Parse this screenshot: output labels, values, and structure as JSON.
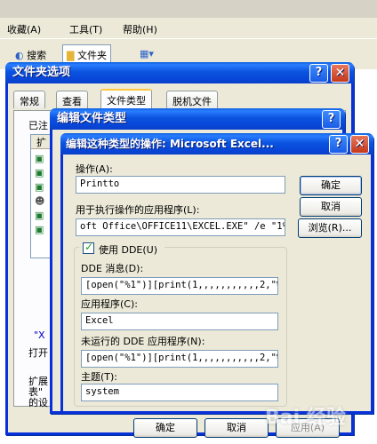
{
  "explorer": {
    "menu": [
      "收藏(A)",
      "工具(T)",
      "帮助(H)"
    ],
    "toolbar": {
      "search_label": "搜索",
      "folders_label": "文件夹"
    },
    "bottom_buttons": {
      "ok": "确定",
      "cancel": "取消",
      "apply": "应用(A)"
    }
  },
  "folder_options": {
    "title": "文件夹选项",
    "tabs": [
      "常规",
      "查看",
      "文件类型",
      "脱机文件"
    ],
    "active_tab": "文件类型",
    "registered_label": "已注",
    "list_header": "扩",
    "side_texts": [
      "\"X",
      "打开",
      "扩展",
      "表\"",
      "的设"
    ]
  },
  "edit_file_type": {
    "title": "编辑文件类型"
  },
  "edit_action": {
    "title": "编辑这种类型的操作: Microsoft Excel...",
    "action_label": "操作(A):",
    "action_value": "Printto",
    "app_label": "用于执行操作的应用程序(L):",
    "app_value": "oft Office\\OFFICE11\\EXCEL.EXE\" /e \"1%\"",
    "ok_button": "确定",
    "cancel_button": "取消",
    "browse_button": "浏览(R)...",
    "use_dde_label": "使用 DDE(U)",
    "use_dde_checked": true,
    "dde_message_label": "DDE 消息(D):",
    "dde_message_value": "[open(\"%1\")][print(1,,,,,,,,,,,2,\"%",
    "application_label": "应用程序(C):",
    "application_value": "Excel",
    "dde_not_running_label": "未运行的 DDE 应用程序(N):",
    "dde_not_running_value": "[open(\"%1\")][print(1,,,,,,,,,,,2,\"%",
    "topic_label": "主题(T):",
    "topic_value": "system"
  },
  "watermark": "Bai 经验"
}
